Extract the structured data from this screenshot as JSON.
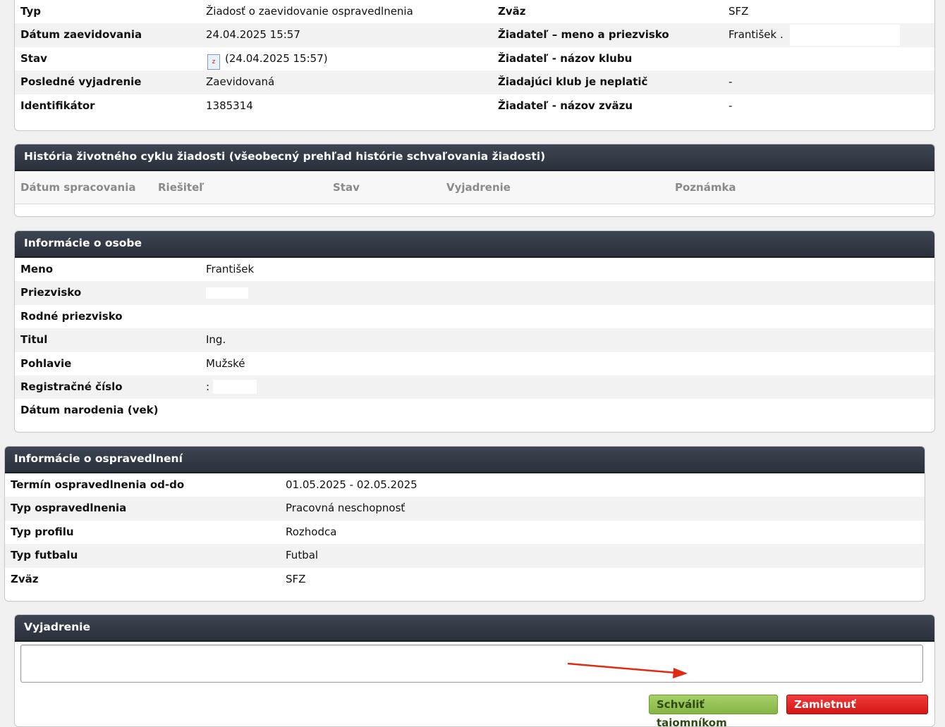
{
  "request": {
    "rows": [
      {
        "l1": "Typ",
        "v1": "Žiadosť o zaevidovanie ospravedlnenia",
        "l2": "Zväz",
        "v2": "SFZ"
      },
      {
        "l1": "Dátum zaevidovania",
        "v1": "24.04.2025 15:57",
        "l2": "Žiadateľ – meno a priezvisko",
        "v2": "František ."
      },
      {
        "l1": "Stav",
        "v1": "(24.04.2025 15:57)",
        "l2": "Žiadateľ - názov klubu",
        "v2": ""
      },
      {
        "l1": "Posledné vyjadrenie",
        "v1": "Zaevidovaná",
        "l2": "Žiadajúci klub je neplatič",
        "v2": "-"
      },
      {
        "l1": "Identifikátor",
        "v1": "1385314",
        "l2": "Žiadateľ - názov zväzu",
        "v2": "-"
      }
    ]
  },
  "history": {
    "title": "História životného cyklu žiadosti (všeobecný prehľad histórie schvaľovania žiadosti)",
    "columns": [
      "Dátum spracovania",
      "Riešiteľ",
      "Stav",
      "Vyjadrenie",
      "Poznámka"
    ]
  },
  "person": {
    "title": "Informácie o osobe",
    "rows": [
      {
        "label": "Meno",
        "value": "František"
      },
      {
        "label": "Priezvisko",
        "value": ""
      },
      {
        "label": "Rodné priezvisko",
        "value": ""
      },
      {
        "label": "Titul",
        "value": "Ing."
      },
      {
        "label": "Pohlavie",
        "value": "Mužské"
      },
      {
        "label": "Registračné číslo",
        "value": ":"
      },
      {
        "label": "Dátum narodenia (vek)",
        "value": ""
      }
    ]
  },
  "excuse": {
    "title": "Informácie o ospravedlnení",
    "rows": [
      {
        "label": "Termín ospravedlnenia od-do",
        "value": "01.05.2025 - 02.05.2025"
      },
      {
        "label": "Typ ospravedlnenia",
        "value": "Pracovná neschopnosť"
      },
      {
        "label": "Typ profilu",
        "value": "Rozhodca"
      },
      {
        "label": "Typ futbalu",
        "value": "Futbal"
      },
      {
        "label": "Zväz",
        "value": "SFZ"
      }
    ]
  },
  "statement": {
    "title": "Vyjadrenie",
    "textarea_value": "",
    "approve_label": "Schváliť tajomníkom",
    "reject_label": "Zamietnuť tajomníkom"
  },
  "colors": {
    "annotation_arrow": "#e02a12",
    "approve": "#86b445",
    "reject": "#d41515",
    "header": "#2b313b"
  }
}
